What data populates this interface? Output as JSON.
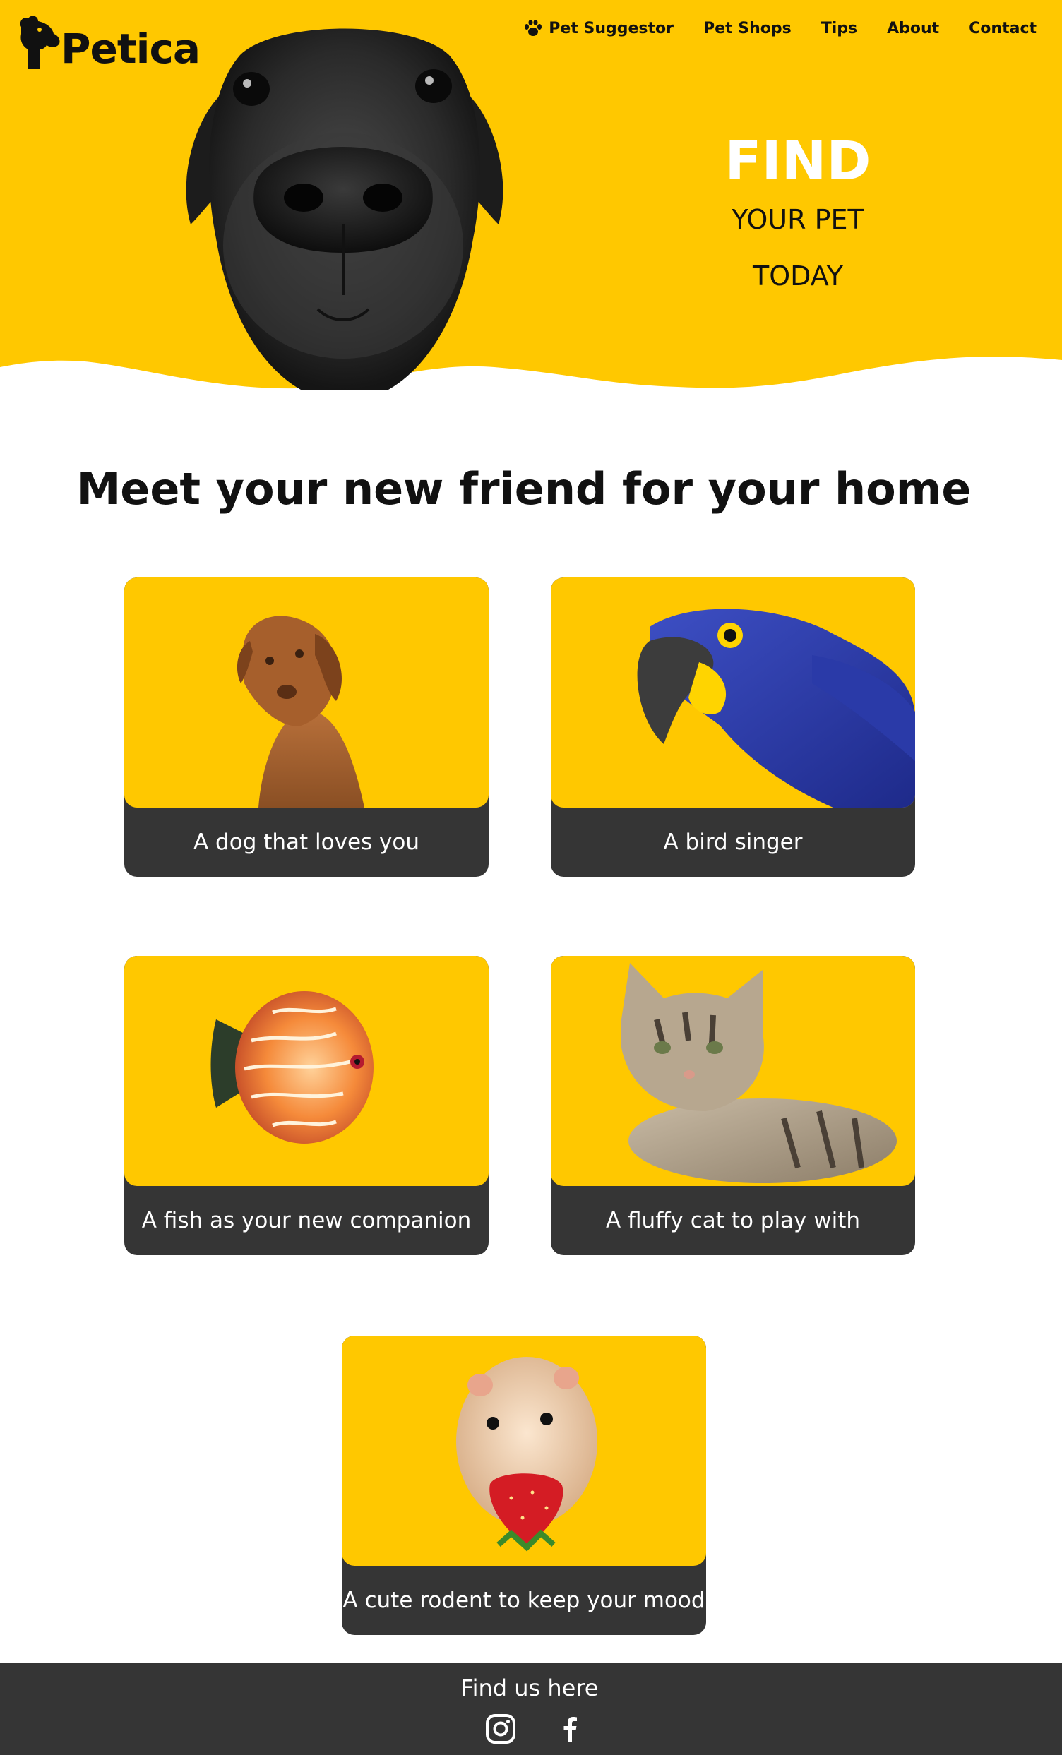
{
  "app": {
    "brand": "Petica"
  },
  "nav": {
    "items": [
      {
        "label": "Pet Suggestor",
        "icon": "paw-icon"
      },
      {
        "label": "Pet Shops"
      },
      {
        "label": "Tips"
      },
      {
        "label": "About"
      },
      {
        "label": "Contact"
      }
    ]
  },
  "hero": {
    "find": "FIND",
    "line2": "YOUR PET",
    "line3": "TODAY"
  },
  "main": {
    "title": "Meet your new friend for your home",
    "cards": [
      {
        "label": "A dog that loves you",
        "icon": "dog-image"
      },
      {
        "label": "A bird singer",
        "icon": "parrot-image"
      },
      {
        "label": "A fish as your new companion",
        "icon": "fish-image"
      },
      {
        "label": "A fluffy cat to play with",
        "icon": "cat-image"
      },
      {
        "label": "A cute rodent to keep your mood",
        "icon": "hamster-image"
      }
    ]
  },
  "footer": {
    "title": "Find us here",
    "social": [
      "instagram-icon",
      "facebook-icon"
    ]
  },
  "colors": {
    "accent": "#ffc800",
    "dark": "#353535",
    "text": "#111111",
    "white": "#ffffff"
  }
}
